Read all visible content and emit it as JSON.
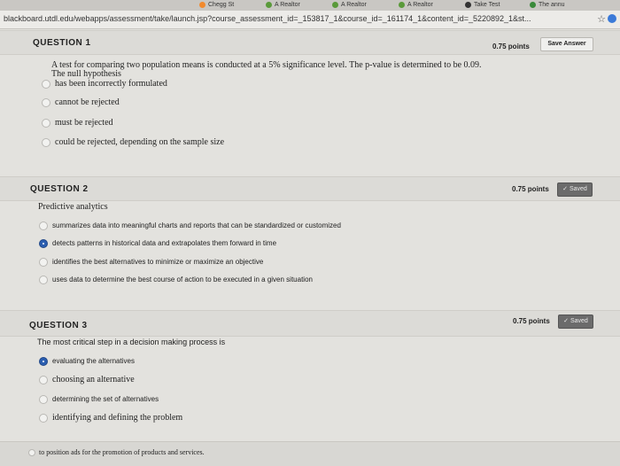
{
  "browser": {
    "tabs": [
      {
        "label": "Chegg St",
        "color": "#f18a2e"
      },
      {
        "label": "A Realtor",
        "color": "#5a9a3a"
      },
      {
        "label": "A Realtor",
        "color": "#5a9a3a"
      },
      {
        "label": "A Realtor",
        "color": "#5a9a3a"
      },
      {
        "label": "Take Test",
        "color": "#333333"
      },
      {
        "label": "The annu",
        "color": "#3a8a3a"
      }
    ],
    "url": "blackboard.utdl.edu/webapps/assessment/take/launch.jsp?course_assessment_id=_153817_1&course_id=_161174_1&content_id=_5220892_1&st..."
  },
  "q1": {
    "title": "QUESTION 1",
    "points": "0.75 points",
    "button": "Save Answer",
    "text_line1": "A test for comparing two population means is conducted at a 5% significance level. The p-value is determined to be 0.09.",
    "text_line2": "The null hypothesis",
    "options": [
      "has been incorrectly formulated",
      "cannot be rejected",
      "must be rejected",
      "could be rejected, depending on the sample size"
    ]
  },
  "q2": {
    "title": "QUESTION 2",
    "points": "0.75 points",
    "button": "Saved",
    "text": "Predictive analytics",
    "options": [
      "summarizes data into meaningful charts and reports that can be standardized or customized",
      "detects patterns in historical data and extrapolates them forward in time",
      "identifies the best alternatives to minimize or maximize an objective",
      "uses data to determine the best course of action to be executed in a given situation"
    ],
    "selected_index": 1
  },
  "q3": {
    "title": "QUESTION 3",
    "points": "0.75 points",
    "button": "Saved",
    "text": "The most critical step in a decision making process is",
    "options": [
      "evaluating the alternatives",
      "choosing an alternative",
      "determining the set of alternatives",
      "identifying and defining the problem"
    ],
    "selected_index": 0
  },
  "q4_partial": {
    "option": "to position ads for the promotion of products and services."
  }
}
